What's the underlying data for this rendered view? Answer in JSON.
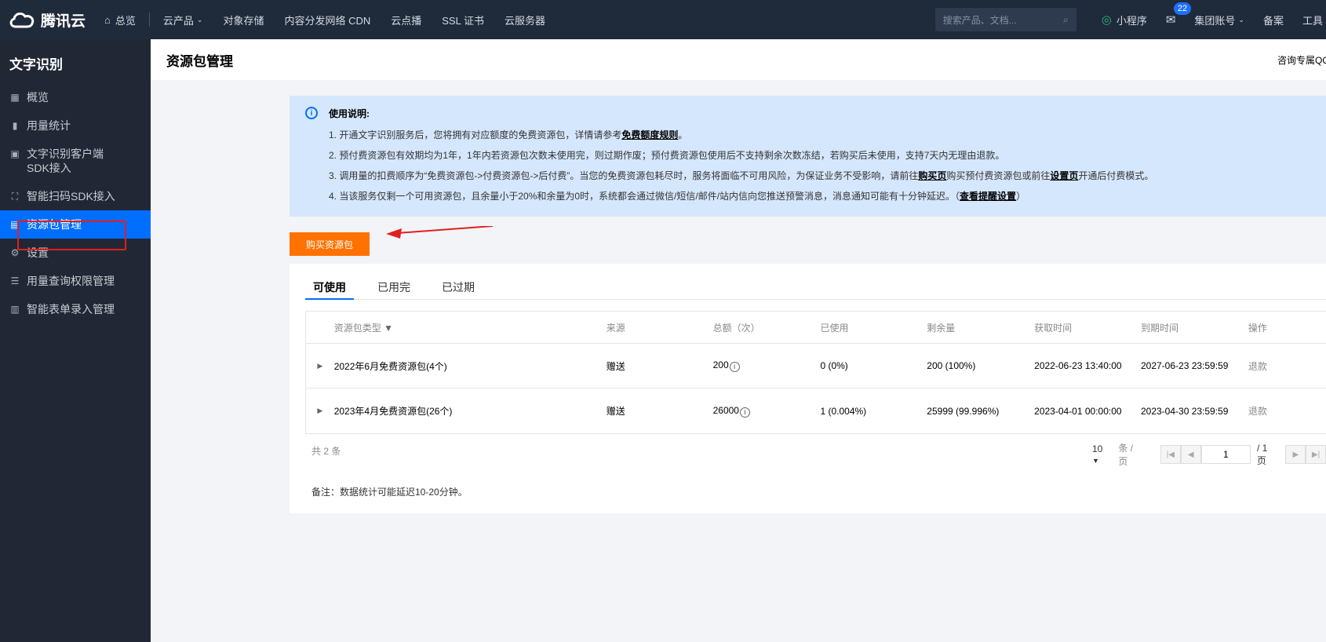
{
  "topbar": {
    "logo_text": "腾讯云",
    "nav": [
      "总览",
      "云产品",
      "对象存储",
      "内容分发网络 CDN",
      "云点播",
      "SSL 证书",
      "云服务器"
    ],
    "search_placeholder": "搜索产品、文档...",
    "mini_program": "小程序",
    "mail_badge": "22",
    "account": "集团账号",
    "beian": "备案",
    "tools": "工具"
  },
  "sidebar": {
    "title": "文字识别",
    "items": [
      {
        "label": "概览",
        "icon": "grid-icon"
      },
      {
        "label": "用量统计",
        "icon": "bar-chart-icon"
      },
      {
        "label": "文字识别客户端SDK接入",
        "icon": "text-box-icon"
      },
      {
        "label": "智能扫码SDK接入",
        "icon": "scan-icon"
      },
      {
        "label": "资源包管理",
        "icon": "package-icon"
      },
      {
        "label": "设置",
        "icon": "gear-icon"
      },
      {
        "label": "用量查询权限管理",
        "icon": "sliders-icon"
      },
      {
        "label": "智能表单录入管理",
        "icon": "form-icon"
      }
    ],
    "active_index": 4
  },
  "header": {
    "title": "资源包管理",
    "right_text": "咨询专属QQ"
  },
  "notice": {
    "title": "使用说明:",
    "l1_pre": "1. 开通文字识别服务后，您将拥有对应额度的免费资源包，详情请参考",
    "l1_link": "免费额度规则",
    "l1_post": "。",
    "l2": "2. 预付费资源包有效期均为1年，1年内若资源包次数未使用完，则过期作废；预付费资源包使用后不支持剩余次数冻结，若购买后未使用，支持7天内无理由退款。",
    "l3_pre": "3. 调用量的扣费顺序为“免费资源包->付费资源包->后付费”。当您的免费资源包耗尽时，服务将面临不可用风险，为保证业务不受影响，请前往",
    "l3_link1": "购买页",
    "l3_mid": "购买预付费资源包或前往",
    "l3_link2": "设置页",
    "l3_post": "开通后付费模式。",
    "l4_pre": "4. 当该服务仅剩一个可用资源包，且余量小于20%和余量为0时，系统都会通过微信/短信/邮件/站内信向您推送预警消息，消息通知可能有十分钟延迟。（",
    "l4_link": "查看提醒设置",
    "l4_post": "）"
  },
  "buy_button": "购买资源包",
  "tabs": [
    "可使用",
    "已用完",
    "已过期"
  ],
  "table": {
    "headers": [
      "资源包类型",
      "来源",
      "总额（次）",
      "已使用",
      "剩余量",
      "获取时间",
      "到期时间",
      "操作"
    ],
    "rows": [
      {
        "type": "2022年6月免费资源包(4个)",
        "source": "赠送",
        "total": "200",
        "used": "0 (0%)",
        "remain": "200 (100%)",
        "get_time": "2022-06-23 13:40:00",
        "expire": "2027-06-23 23:59:59",
        "op": "退款"
      },
      {
        "type": "2023年4月免费资源包(26个)",
        "source": "赠送",
        "total": "26000",
        "used": "1 (0.004%)",
        "remain": "25999 (99.996%)",
        "get_time": "2023-04-01 00:00:00",
        "expire": "2023-04-30 23:59:59",
        "op": "退款"
      }
    ]
  },
  "footer": {
    "count": "共 2 条",
    "page_size": "10",
    "per_page": "条 / 页",
    "page": "1",
    "total_pages": "/ 1 页"
  },
  "remark": "备注：数据统计可能延迟10-20分钟。",
  "colors": {
    "accent": "#006eff",
    "buy": "#ff7200",
    "highlight_box": "#e02020",
    "topbar": "#1f2a3a",
    "sidebar": "#212734"
  }
}
